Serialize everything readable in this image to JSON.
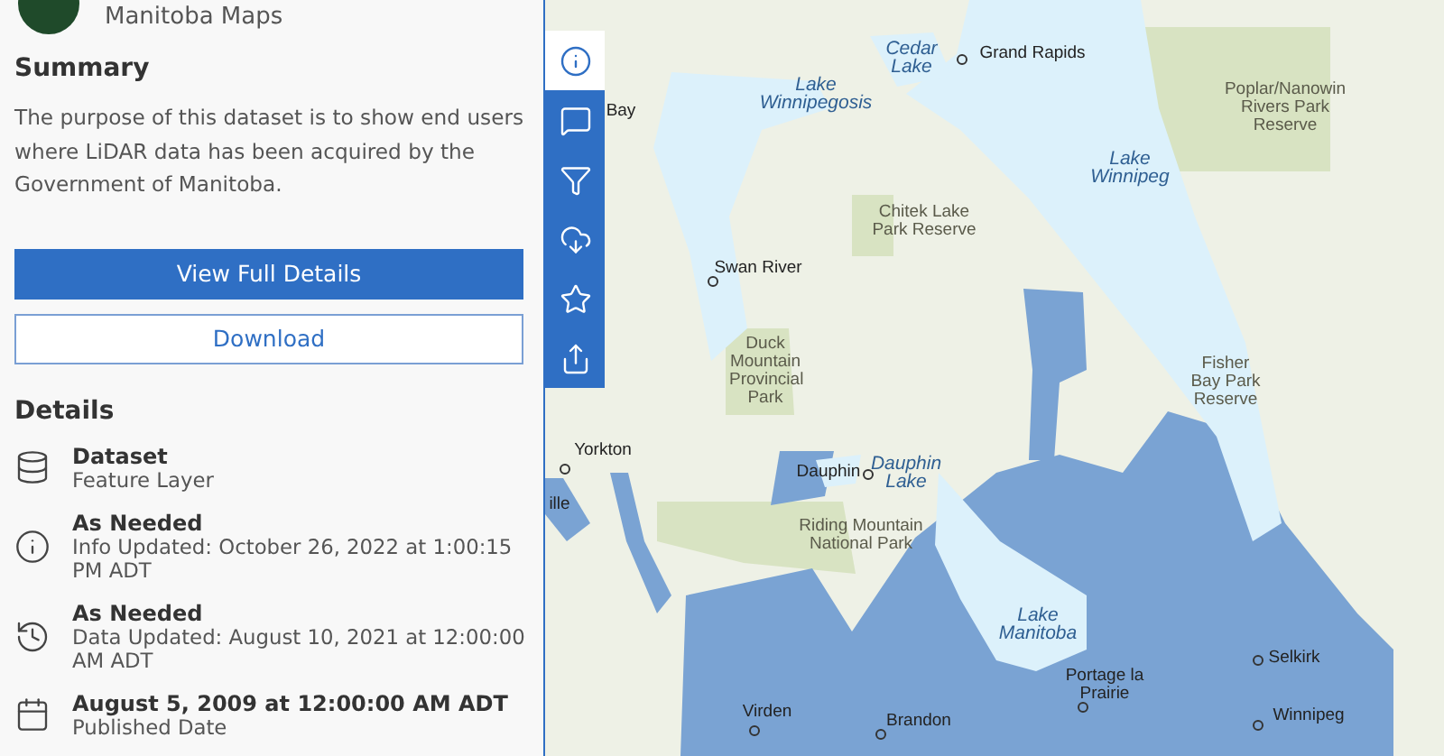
{
  "header": {
    "title": "Manitoba Maps"
  },
  "toolbar": [
    {
      "kind": "info",
      "selected": true
    },
    {
      "kind": "comment",
      "selected": false
    },
    {
      "kind": "filter",
      "selected": false
    },
    {
      "kind": "download",
      "selected": false
    },
    {
      "kind": "favorite",
      "selected": false
    },
    {
      "kind": "share",
      "selected": false
    }
  ],
  "summary": {
    "heading": "Summary",
    "text": "The purpose of this dataset is to show end users where LiDAR data has been acquired by the Government of Manitoba.",
    "buttons": [
      {
        "label": "View Full Details",
        "kind": "primary"
      },
      {
        "label": "Download",
        "kind": "outline"
      }
    ]
  },
  "details": {
    "heading": "Details",
    "items": [
      {
        "kind": "dataset",
        "title": "Dataset",
        "subtitle": "Feature Layer"
      },
      {
        "kind": "info",
        "title": "As Needed",
        "subtitle": "Info Updated: October 26, 2022 at 1:00:15 PM ADT"
      },
      {
        "kind": "history",
        "title": "As Needed",
        "subtitle": "Data Updated: August 10, 2021 at 12:00:00 AM ADT"
      },
      {
        "kind": "calendar",
        "title": "August 5, 2009 at 12:00:00 AM ADT",
        "subtitle": "Published Date"
      }
    ]
  },
  "map": {
    "labels": [
      {
        "text": "Bay",
        "kind": "city"
      },
      {
        "text": "Cedar Lake",
        "kind": "lake"
      },
      {
        "text": "Grand Rapids",
        "kind": "city"
      },
      {
        "text": "Lake Winnipegosis",
        "kind": "lake"
      },
      {
        "text": "Poplar/Nanowin Rivers Park Reserve",
        "kind": "park"
      },
      {
        "text": "Lake Winnipeg",
        "kind": "lake"
      },
      {
        "text": "Chitek Lake Park Reserve",
        "kind": "park"
      },
      {
        "text": "Swan River",
        "kind": "city"
      },
      {
        "text": "Duck Mountain Provincial Park",
        "kind": "park"
      },
      {
        "text": "Fisher Bay Park Reserve",
        "kind": "park"
      },
      {
        "text": "Yorkton",
        "kind": "city"
      },
      {
        "text": "ille",
        "kind": "city"
      },
      {
        "text": "Dauphin",
        "kind": "city"
      },
      {
        "text": "Dauphin Lake",
        "kind": "lake"
      },
      {
        "text": "Riding Mountain National Park",
        "kind": "park"
      },
      {
        "text": "Lake Manitoba",
        "kind": "lake"
      },
      {
        "text": "Selkirk",
        "kind": "city"
      },
      {
        "text": "Portage la Prairie",
        "kind": "city"
      },
      {
        "text": "Virden",
        "kind": "city"
      },
      {
        "text": "Brandon",
        "kind": "city"
      },
      {
        "text": "Winnipeg",
        "kind": "city"
      }
    ]
  }
}
